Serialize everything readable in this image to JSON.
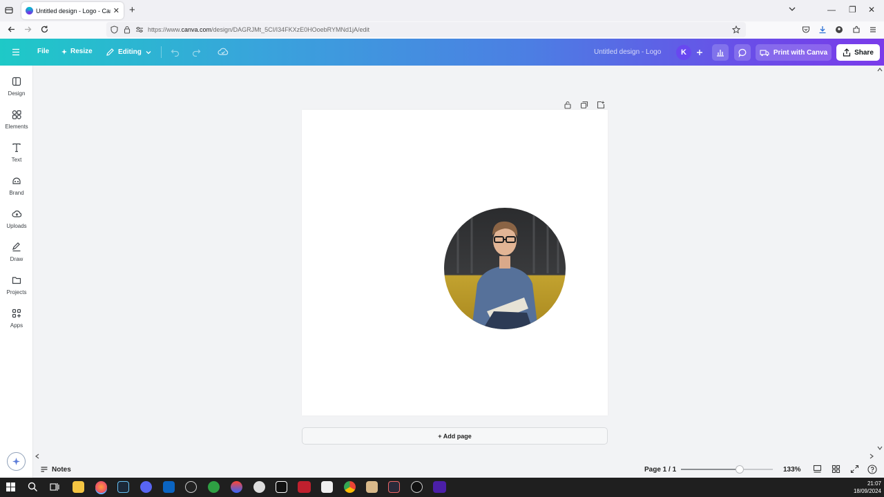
{
  "browser": {
    "tab_title": "Untitled design - Logo - Canva",
    "tab_close": "✕",
    "new_tab": "+",
    "url_prefix": "https://www.",
    "url_host": "canva.com",
    "url_path": "/design/DAGRJMt_5CI/I34FKXzE0HOoebRYMNd1jA/edit",
    "window_controls": [
      "—",
      "❐",
      "✕"
    ]
  },
  "canva_header": {
    "menu_icon": "hamburger-icon",
    "file": "File",
    "resize": "Resize",
    "editing": "Editing",
    "design_title": "Untitled design - Logo",
    "avatar_initial": "K",
    "print_label": "Print with Canva",
    "share_label": "Share"
  },
  "sidebar": {
    "items": [
      {
        "label": "Design",
        "icon": "layout-icon"
      },
      {
        "label": "Elements",
        "icon": "shapes-icon"
      },
      {
        "label": "Text",
        "icon": "text-icon"
      },
      {
        "label": "Brand",
        "icon": "brand-icon"
      },
      {
        "label": "Uploads",
        "icon": "cloud-upload-icon"
      },
      {
        "label": "Draw",
        "icon": "pen-icon"
      },
      {
        "label": "Projects",
        "icon": "folder-icon"
      },
      {
        "label": "Apps",
        "icon": "apps-icon"
      }
    ]
  },
  "canvas": {
    "add_page": "+ Add page",
    "image_subject": "circular portrait photo of a man with glasses writing in a notebook"
  },
  "bottom_bar": {
    "notes": "Notes",
    "page_info": "Page 1 / 1",
    "zoom_percent": "133%",
    "zoom_slider_fraction": 0.64
  },
  "taskbar": {
    "time": "21:07",
    "date": "18/09/2024"
  },
  "colors": {
    "header_gradient_start": "#1ec9c7",
    "header_gradient_end": "#7a3bea",
    "avatar": "#6848f0"
  }
}
